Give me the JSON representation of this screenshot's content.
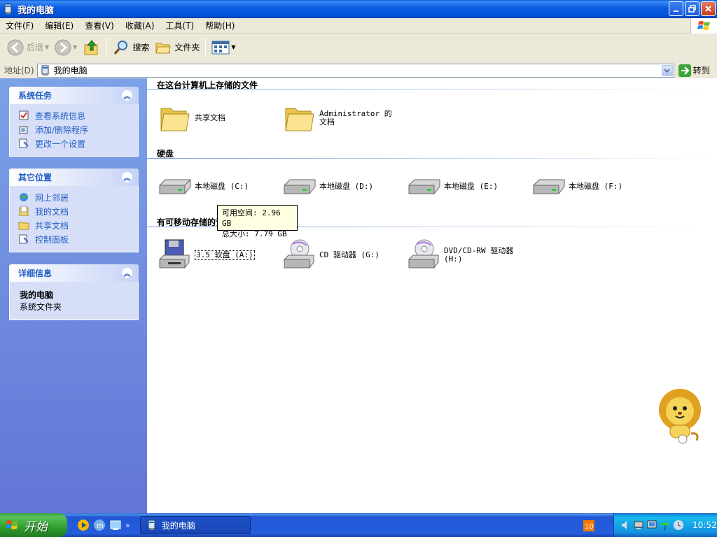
{
  "window": {
    "title": "我的电脑",
    "buttons": [
      "minimize",
      "restore",
      "close"
    ]
  },
  "menubar": {
    "items": [
      "文件(F)",
      "编辑(E)",
      "查看(V)",
      "收藏(A)",
      "工具(T)",
      "帮助(H)"
    ]
  },
  "toolbar": {
    "back": "后退",
    "search": "搜索",
    "folders": "文件夹"
  },
  "addressbar": {
    "label": "地址(D)",
    "value": "我的电脑",
    "go": "转到"
  },
  "sidebar": {
    "system_tasks": {
      "title": "系统任务",
      "items": [
        "查看系统信息",
        "添加/删除程序",
        "更改一个设置"
      ]
    },
    "other_places": {
      "title": "其它位置",
      "items": [
        "网上邻居",
        "我的文档",
        "共享文档",
        "控制面板"
      ]
    },
    "details": {
      "title": "详细信息",
      "name": "我的电脑",
      "type": "系统文件夹"
    }
  },
  "main": {
    "groups": [
      {
        "header": "在这台计算机上存储的文件",
        "items": [
          {
            "label": "共享文档",
            "icon": "folder-icon"
          },
          {
            "label": "Administrator 的文档",
            "icon": "folder-icon"
          }
        ]
      },
      {
        "header": "硬盘",
        "items": [
          {
            "label": "本地磁盘 (C:)",
            "icon": "hard-drive-icon"
          },
          {
            "label": "本地磁盘 (D:)",
            "icon": "hard-drive-icon"
          },
          {
            "label": "本地磁盘 (E:)",
            "icon": "hard-drive-icon"
          },
          {
            "label": "本地磁盘 (F:)",
            "icon": "hard-drive-icon"
          }
        ]
      },
      {
        "header": "有可移动存储的设备",
        "items": [
          {
            "label": "3.5 软盘 (A:)",
            "icon": "floppy-drive-icon",
            "selected": true
          },
          {
            "label": "CD 驱动器 (G:)",
            "icon": "cd-drive-icon"
          },
          {
            "label": "DVD/CD-RW 驱动器 (H:)",
            "icon": "dvd-drive-icon"
          }
        ]
      }
    ],
    "tooltip": {
      "free": "可用空间: 2.96 GB",
      "total": "总大小: 7.79 GB"
    }
  },
  "taskbar": {
    "start": "开始",
    "window_button": "我的电脑",
    "clock": "10:52"
  },
  "colors": {
    "titlebar": "#0054e3",
    "sidebar": "#7ba2e7",
    "link": "#215dc6",
    "start": "#3c9e3c",
    "tray": "#139ee9"
  }
}
